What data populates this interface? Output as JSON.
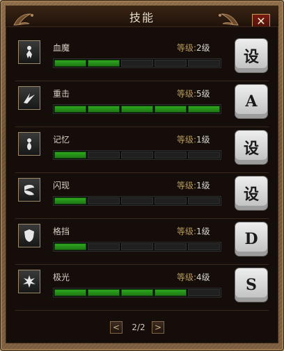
{
  "window": {
    "title": "技能",
    "close_label": "✕"
  },
  "labels": {
    "level_prefix": "等级:"
  },
  "skills": [
    {
      "name": "血魔",
      "level_text": "2级",
      "progress": 2,
      "max": 5,
      "key": "设",
      "icon": "blood-demon-icon"
    },
    {
      "name": "重击",
      "level_text": "5级",
      "progress": 5,
      "max": 5,
      "key": "A",
      "icon": "heavy-strike-icon"
    },
    {
      "name": "记忆",
      "level_text": "1级",
      "progress": 1,
      "max": 5,
      "key": "设",
      "icon": "memory-icon"
    },
    {
      "name": "闪现",
      "level_text": "1级",
      "progress": 1,
      "max": 5,
      "key": "设",
      "icon": "flash-icon"
    },
    {
      "name": "格挡",
      "level_text": "1级",
      "progress": 1,
      "max": 5,
      "key": "D",
      "icon": "block-icon"
    },
    {
      "name": "极光",
      "level_text": "4级",
      "progress": 4,
      "max": 5,
      "key": "S",
      "icon": "aurora-icon"
    }
  ],
  "pager": {
    "prev_label": "<",
    "next_label": ">",
    "page_text": "2/2"
  },
  "colors": {
    "bar_on": "#2ea61f",
    "bar_off": "#202020",
    "title_text": "#f1e4c9",
    "level_label": "#b59a5d"
  }
}
